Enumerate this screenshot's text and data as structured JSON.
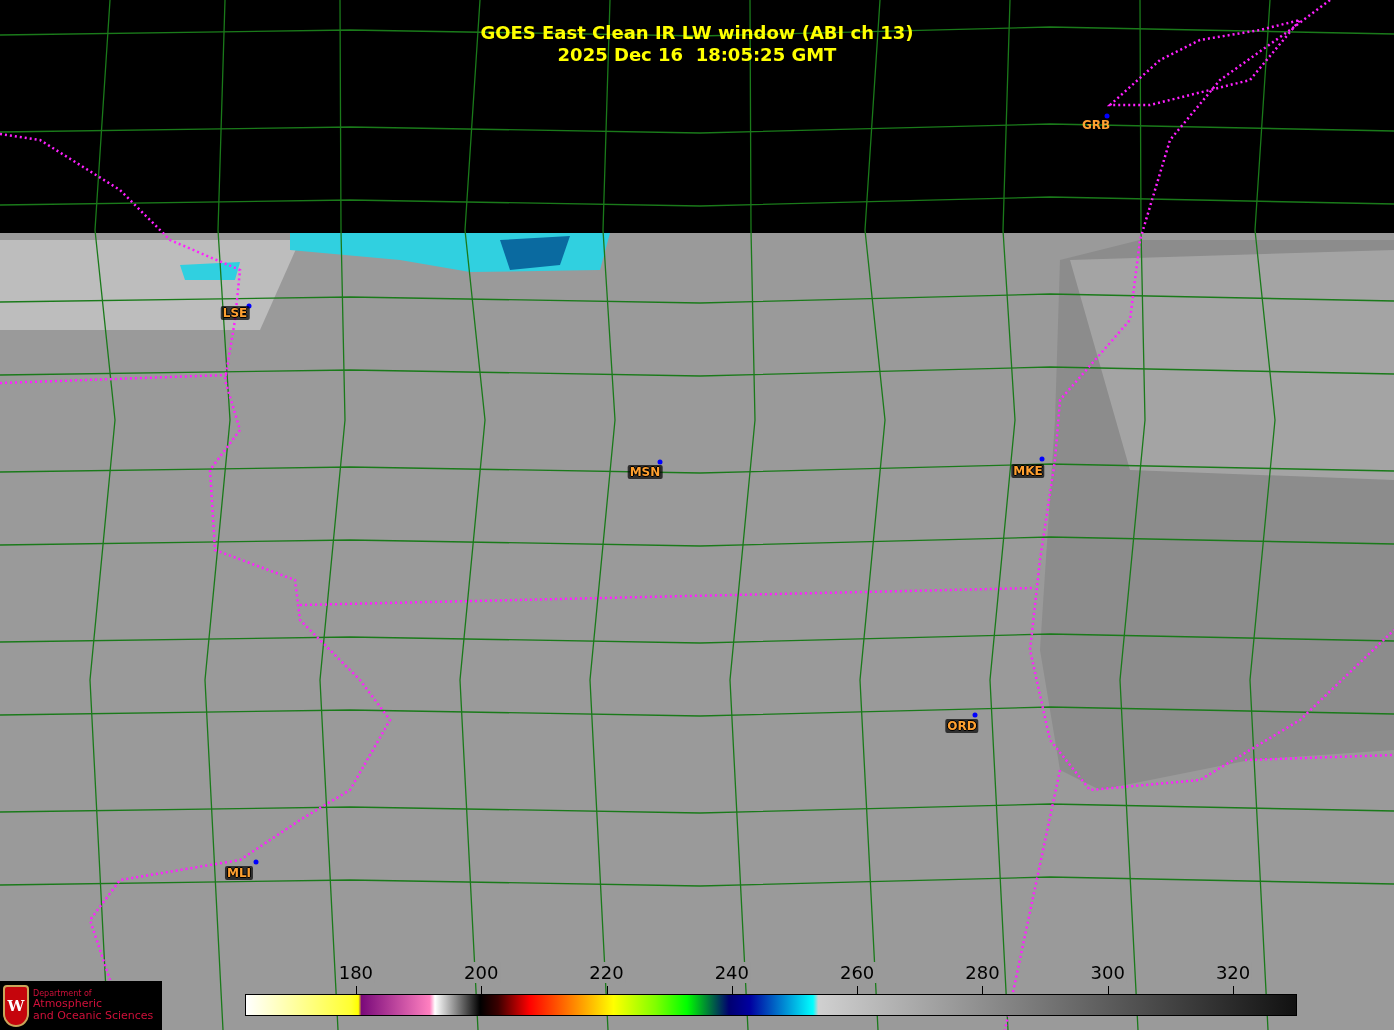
{
  "title": {
    "product": "GOES East Clean IR LW window (ABI ch 13)",
    "timestamp": "2025 Dec 16  18:05:25 GMT"
  },
  "cities": [
    {
      "label": "GRB"
    },
    {
      "label": "LSE"
    },
    {
      "label": "MSN"
    },
    {
      "label": "MKE"
    },
    {
      "label": "ORD"
    },
    {
      "label": "MLI"
    }
  ],
  "colorbar": {
    "ticks": [
      "180",
      "200",
      "220",
      "240",
      "260",
      "280",
      "300",
      "320"
    ]
  },
  "logo": {
    "crest_letter": "W",
    "lines": [
      "Department of",
      "Atmospheric",
      "and Oceanic Sciences"
    ]
  }
}
